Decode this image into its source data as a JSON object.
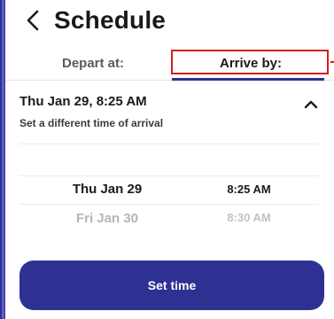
{
  "header": {
    "title": "Schedule"
  },
  "tabs": {
    "depart_label": "Depart at:",
    "arrive_label": "Arrive by:",
    "active": "arrive"
  },
  "summary": {
    "datetime": "Thu Jan 29, 8:25 AM",
    "subtitle": "Set a different time of arrival"
  },
  "picker": {
    "dates": [
      "Thu Jan 29",
      "Fri Jan 30"
    ],
    "times": [
      "8:25 AM",
      "8:30 AM"
    ],
    "selected_date": "Thu Jan 29",
    "selected_time": "8:25 AM"
  },
  "action": {
    "set_time_label": "Set time"
  },
  "colors": {
    "primary": "#2e3192",
    "highlight_outline": "#d21f1f"
  },
  "icons": {
    "back": "chevron-left-icon",
    "collapse": "chevron-up-icon"
  }
}
